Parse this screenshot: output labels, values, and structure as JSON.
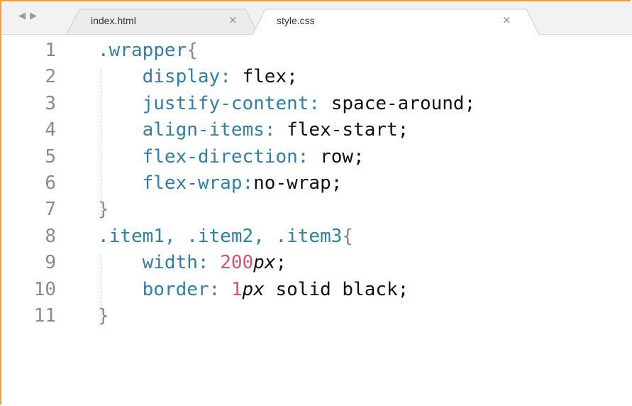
{
  "tabs": [
    {
      "label": "index.html",
      "close": "×",
      "active": false
    },
    {
      "label": "style.css",
      "close": "×",
      "active": true
    }
  ],
  "nav_arrows": "◀ ▶",
  "lines": [
    {
      "num": "1",
      "parts": [
        {
          "t": ".wrapper",
          "c": "cls"
        },
        {
          "t": "{",
          "c": "b"
        }
      ]
    },
    {
      "num": "2",
      "parts": [
        {
          "t": "    display",
          "c": "k"
        },
        {
          "t": ": ",
          "c": "k"
        },
        {
          "t": "flex",
          "c": "v"
        },
        {
          "t": ";",
          "c": "p"
        }
      ]
    },
    {
      "num": "3",
      "parts": [
        {
          "t": "    justify-content",
          "c": "k"
        },
        {
          "t": ": ",
          "c": "k"
        },
        {
          "t": "space-around",
          "c": "v"
        },
        {
          "t": ";",
          "c": "p"
        }
      ]
    },
    {
      "num": "4",
      "parts": [
        {
          "t": "    align-items",
          "c": "k"
        },
        {
          "t": ": ",
          "c": "k"
        },
        {
          "t": "flex-start",
          "c": "v"
        },
        {
          "t": ";",
          "c": "p"
        }
      ]
    },
    {
      "num": "5",
      "parts": [
        {
          "t": "    flex-direction",
          "c": "k"
        },
        {
          "t": ": ",
          "c": "k"
        },
        {
          "t": "row",
          "c": "v"
        },
        {
          "t": ";",
          "c": "p"
        }
      ]
    },
    {
      "num": "6",
      "parts": [
        {
          "t": "    flex-wrap",
          "c": "k"
        },
        {
          "t": ":",
          "c": "k"
        },
        {
          "t": "no-wrap",
          "c": "v"
        },
        {
          "t": ";",
          "c": "p"
        }
      ]
    },
    {
      "num": "7",
      "parts": [
        {
          "t": "}",
          "c": "b"
        }
      ]
    },
    {
      "num": "8",
      "parts": [
        {
          "t": ".item1, .item2, .item3",
          "c": "cls"
        },
        {
          "t": "{",
          "c": "b"
        }
      ]
    },
    {
      "num": "9",
      "parts": [
        {
          "t": "    width",
          "c": "k"
        },
        {
          "t": ": ",
          "c": "k"
        },
        {
          "t": "200",
          "c": "n"
        },
        {
          "t": "px",
          "c": "u"
        },
        {
          "t": ";",
          "c": "p"
        }
      ]
    },
    {
      "num": "10",
      "parts": [
        {
          "t": "    border",
          "c": "k"
        },
        {
          "t": ": ",
          "c": "k"
        },
        {
          "t": "1",
          "c": "n"
        },
        {
          "t": "px",
          "c": "u"
        },
        {
          "t": " solid black",
          "c": "v"
        },
        {
          "t": ";",
          "c": "p"
        }
      ]
    },
    {
      "num": "11",
      "parts": [
        {
          "t": "}",
          "c": "b"
        }
      ]
    }
  ]
}
